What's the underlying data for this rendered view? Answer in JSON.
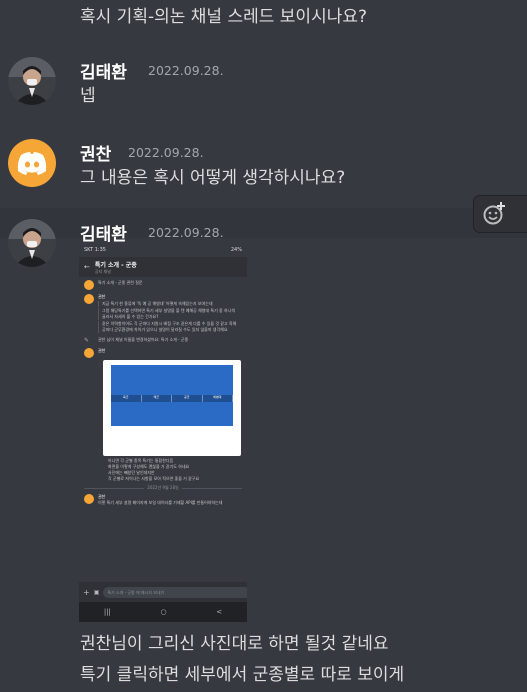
{
  "messages": [
    {
      "text": "혹시 기획-의논 채널 스레드 보이시나요?"
    },
    {
      "author": "김태환",
      "timestamp": "2022.09.28.",
      "text": "넵",
      "avatar_icon": "user-photo"
    },
    {
      "author": "권찬",
      "timestamp": "2022.09.28.",
      "text": "그 내용은 혹시 어떻게 생각하시나요?",
      "avatar_icon": "discord-logo-icon",
      "avatar_color": "#f6a637"
    },
    {
      "author": "김태환",
      "timestamp": "2022.09.28.",
      "attachment": "phone-screenshot"
    },
    {
      "text": "권찬님이 그리신 사진대로 하면 될것 같네요"
    },
    {
      "text": "특기 클릭하면 세부에서 군종별로 따로 보이게"
    }
  ],
  "screenshot": {
    "status_left": "SKT 1:35",
    "status_right": "24%",
    "channel_title": "특기 소개 - 군종",
    "channel_sub": "공지 채널",
    "lines": [
      "특기 소개 - 군종 관련 질문",
      "권찬",
      "지금 특기 한 종류에 '독 예 공 해병대' 어떻게 속해있는지 보여는데",
      "그럼 해당특기를 선택하면 특기 세부 설명을 볼 텐 예해공 해병대 특기 중 하나씩 골라서 자세히 볼 수 있는 건가요?",
      "같은 이력항이어도 각 군마다 지원시 배점 구조 같은게 다를 수 있을 것 같고 육해공마다 군무환경에 차이가 있으니 설명이 달라질 수도 있지 않을까 생각해요",
      "권찬 님이 채널 이름을 변경하셨어요: 특기 소개 - 군종",
      "권찬",
      "아니면 각 군별 종목 특기는 통합한다음",
      "화면을 이렇게 구성해도 괜찮을 거 같기도 하네요",
      "사진에는 빼놨던 날인데지만",
      "각 군별로 저이나는 사항을 모아 적으면 좋을 거 같구요",
      "2022년 9월 28일",
      "권찬",
      "이렇 특기 세부 설명 페이지에 보일 데이터를 기재할 API를 만들어야하는데"
    ],
    "tabs": [
      "육군",
      "해군",
      "공군",
      "해병대"
    ],
    "input_placeholder": "특기 소개 - 군종 에 메시지 보내기",
    "nav": [
      "|||",
      "○",
      "<"
    ]
  }
}
